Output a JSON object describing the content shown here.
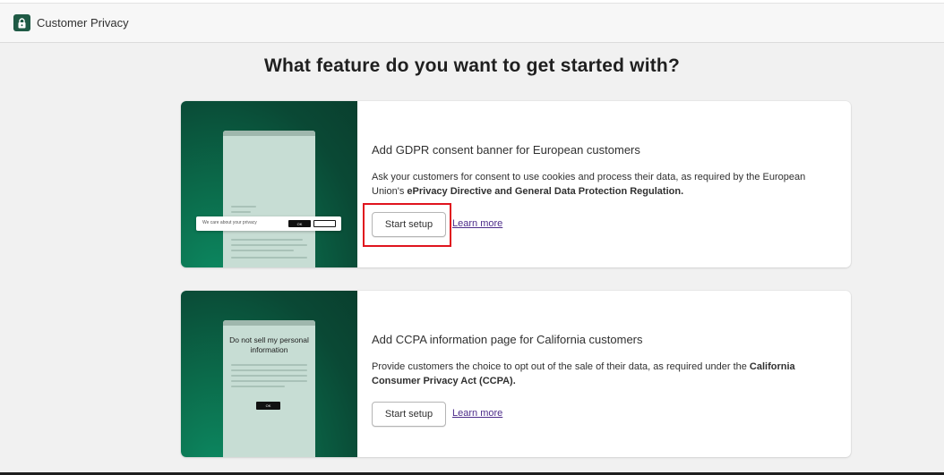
{
  "header": {
    "app_title": "Customer Privacy",
    "icon": "lock-icon"
  },
  "page": {
    "title": "What feature do you want to get started with?"
  },
  "cards": [
    {
      "title": "Add GDPR consent banner for European customers",
      "description_prefix": "Ask your customers for consent to use cookies and process their data, as required by the European Union's ",
      "description_emphasis": "ePrivacy Directive and General Data Protection Regulation.",
      "start_label": "Start setup",
      "learn_label": "Learn more",
      "illustration": {
        "banner_text": "We care about your privacy",
        "ok_label": "OK"
      }
    },
    {
      "title": "Add CCPA information page for California customers",
      "description_prefix": "Provide customers the choice to opt out of the sale of their data, as required under the ",
      "description_emphasis": "California Consumer Privacy Act (CCPA).",
      "start_label": "Start setup",
      "learn_label": "Learn more",
      "illustration": {
        "heading": "Do not sell my personal information",
        "ok_label": "OK"
      }
    }
  ],
  "colors": {
    "brand_green": "#1f5a45",
    "highlight_red": "#e0141e",
    "link_purple": "#4d2c8a"
  }
}
